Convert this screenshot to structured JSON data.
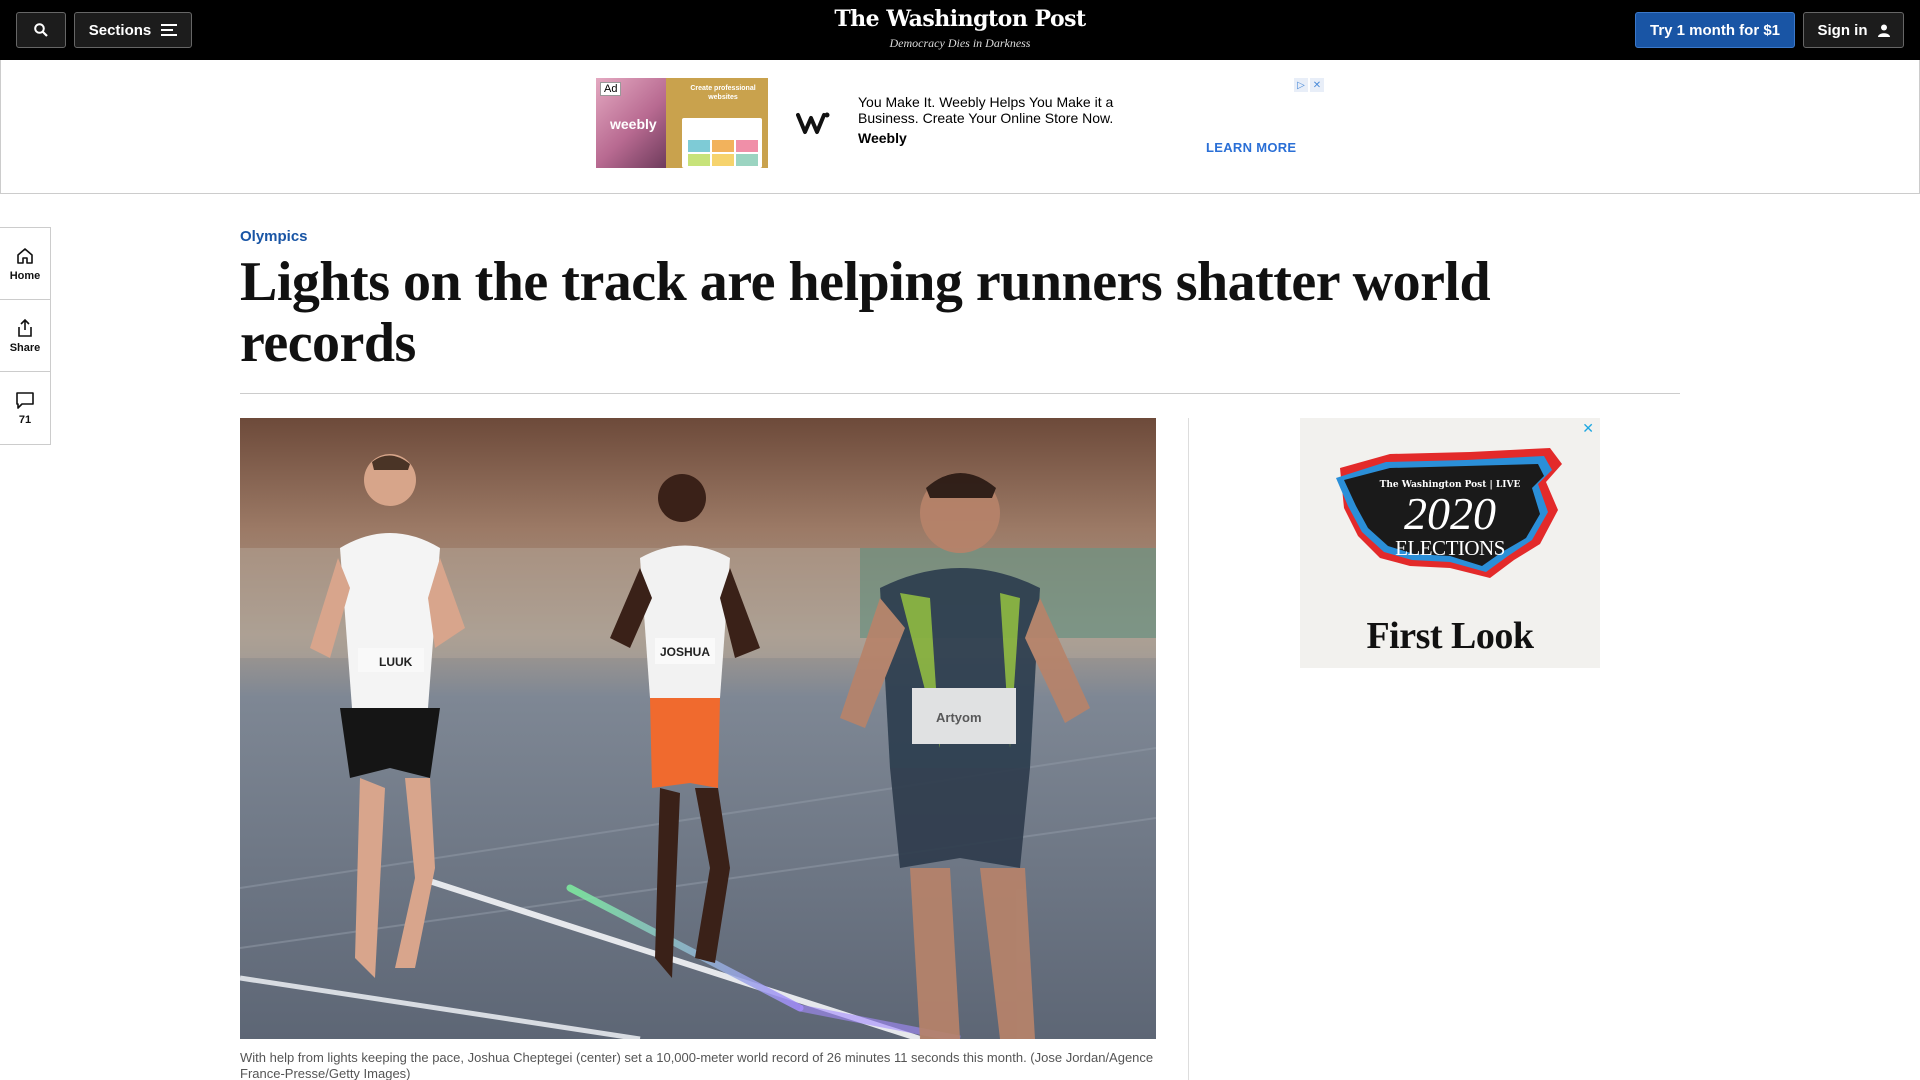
{
  "header": {
    "sections_label": "Sections",
    "masthead": "The Washington Post",
    "tagline": "Democracy Dies in Darkness",
    "subscribe_label": "Try 1 month for $1",
    "signin_label": "Sign in"
  },
  "top_ad": {
    "ad_badge": "Ad",
    "thumb_brand": "weebly",
    "thumb_headline": "Create professional websites",
    "text": "You Make It. Weebly Helps You Make it a Business. Create Your Online Store Now.",
    "brand": "Weebly",
    "cta": "LEARN MORE",
    "colors": {
      "cta": "#2a6fd6",
      "thumb_bg": "#c9a24d"
    }
  },
  "rail": {
    "items": [
      {
        "label": "Home",
        "icon": "home-icon"
      },
      {
        "label": "Share",
        "icon": "share-icon"
      },
      {
        "label": "71",
        "icon": "comment-icon"
      }
    ]
  },
  "article": {
    "kicker": "Olympics",
    "headline": "Lights on the track are helping runners shatter world records",
    "photo_bibs": [
      "LUUK",
      "JOSHUA",
      "Artyom"
    ],
    "caption": "With help from lights keeping the pace, Joshua Cheptegei (center) set a 10,000-meter world record of 26 minutes 11 seconds this month. (Jose Jordan/Agence France-Presse/Getty Images)"
  },
  "side_ad": {
    "brandline": "The Washington Post | LIVE",
    "year": "2020",
    "label": "ELECTIONS",
    "title": "First Look",
    "colors": {
      "red": "#e32a2a",
      "blue": "#2b8fd8",
      "dark": "#1a1a1a"
    }
  },
  "colors": {
    "accent": "#1955a5",
    "topbar": "#000000"
  }
}
